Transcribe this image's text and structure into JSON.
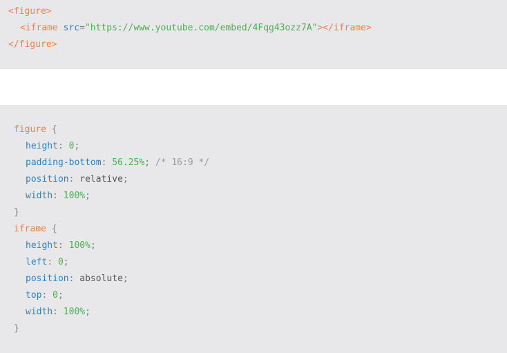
{
  "html_block": {
    "lines": [
      {
        "open": "<figure>"
      },
      {
        "tag_open": "<iframe",
        "attr": "src",
        "eq": "=",
        "value": "\"https://www.youtube.com/embed/4Fqg43ozz7A\"",
        "tag_close": "></iframe>"
      },
      {
        "close": "</figure>"
      }
    ]
  },
  "css_block": {
    "rules": [
      {
        "selector": "figure",
        "open_brace": "{",
        "close_brace": "}",
        "declarations": [
          {
            "property": "height",
            "value": "0",
            "comment": ""
          },
          {
            "property": "padding-bottom",
            "value": "56.25%",
            "comment": "/* 16:9 */"
          },
          {
            "property": "position",
            "value": "relative",
            "comment": ""
          },
          {
            "property": "width",
            "value": "100%",
            "comment": ""
          }
        ]
      },
      {
        "selector": "iframe",
        "open_brace": "{",
        "close_brace": "}",
        "declarations": [
          {
            "property": "height",
            "value": "100%",
            "comment": ""
          },
          {
            "property": "left",
            "value": "0",
            "comment": ""
          },
          {
            "property": "position",
            "value": "absolute",
            "comment": ""
          },
          {
            "property": "top",
            "value": "0",
            "comment": ""
          },
          {
            "property": "width",
            "value": "100%",
            "comment": ""
          }
        ]
      }
    ]
  },
  "colors": {
    "code_background": "#e8e8ea",
    "tag": "#e8834e",
    "attribute": "#2f7fbf",
    "string": "#4caf50",
    "property": "#2f7fbf",
    "number": "#4caf50",
    "keyword_value": "#555555",
    "comment": "#9a9a9a"
  }
}
